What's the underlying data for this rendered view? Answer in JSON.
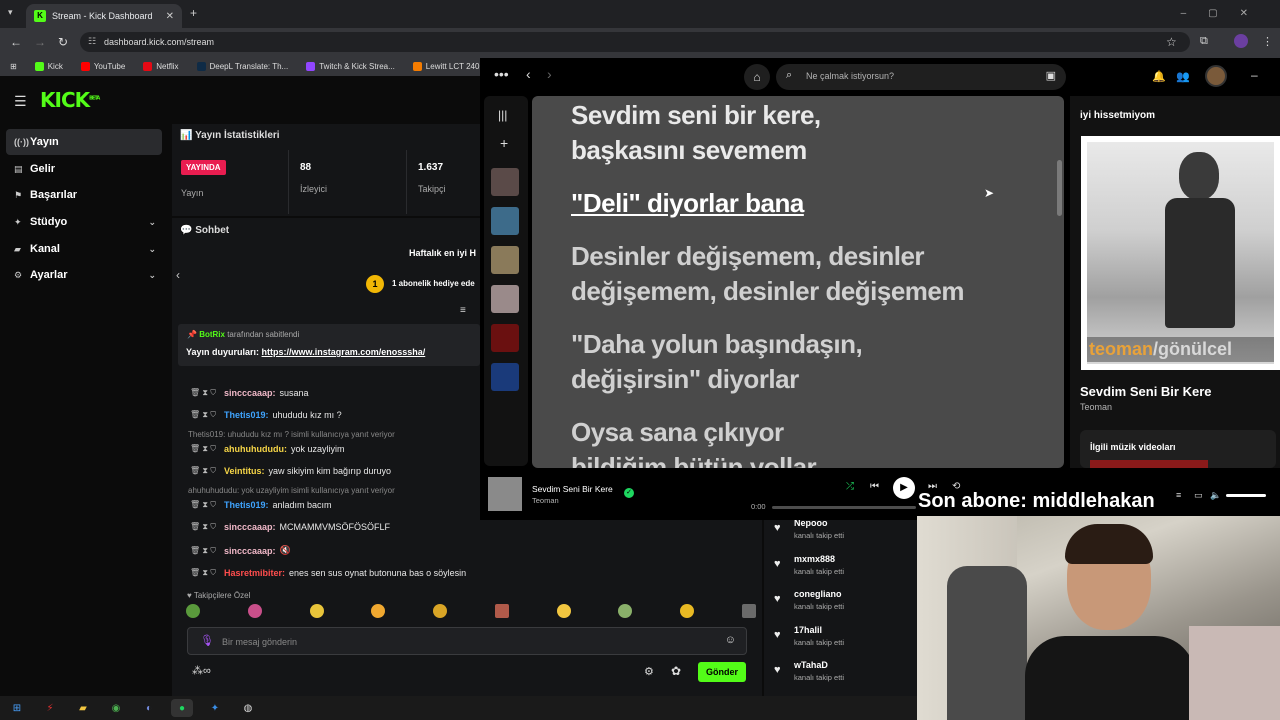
{
  "browser": {
    "tab_title": "Stream - Kick Dashboard",
    "url": "dashboard.kick.com/stream",
    "bookmarks": [
      {
        "label": "Kick",
        "color": "#53fc18"
      },
      {
        "label": "YouTube",
        "color": "#ff0000"
      },
      {
        "label": "Netflix",
        "color": "#e50914"
      },
      {
        "label": "DeepL Translate: Th...",
        "color": "#0f2b46"
      },
      {
        "label": "Twitch & Kick Strea...",
        "color": "#9146ff"
      },
      {
        "label": "Lewitt LCT 240 PRO...",
        "color": "#f57c00"
      }
    ]
  },
  "kick": {
    "logo": "KICK",
    "logo_sup": "BETA",
    "sidebar": [
      {
        "label": "Yayın",
        "icon": "broadcast-icon",
        "glyph": "((·))",
        "active": true,
        "expand": false
      },
      {
        "label": "Gelir",
        "icon": "revenue-icon",
        "glyph": "▤",
        "active": false,
        "expand": false
      },
      {
        "label": "Başarılar",
        "icon": "achievements-icon",
        "glyph": "⚑",
        "active": false,
        "expand": false
      },
      {
        "label": "Stüdyo",
        "icon": "studio-icon",
        "glyph": "✦",
        "active": false,
        "expand": true
      },
      {
        "label": "Kanal",
        "icon": "channel-icon",
        "glyph": "▰",
        "active": false,
        "expand": true
      },
      {
        "label": "Ayarlar",
        "icon": "settings-icon",
        "glyph": "⚙",
        "active": false,
        "expand": true
      }
    ],
    "stats": {
      "title": "Yayın İstatistikleri",
      "live_badge": "YAYINDA",
      "status_label": "Yayın",
      "viewers_value": "88",
      "viewers_label": "İzleyici",
      "followers_value": "1.637",
      "followers_label": "Takipçi"
    },
    "chat": {
      "title": "Sohbet",
      "weekly": "Haftalık en iyi H",
      "gift": "1 abonelik hediye ede",
      "gift_count": "1",
      "pinned_by_user": "BotRix",
      "pinned_by_suffix": "tarafından sabitlendi",
      "pinned_label": "Yayın duyuruları:",
      "pinned_link": "https://www.instagram.com/enosssha/",
      "messages": [
        {
          "user": "sincccaaap:",
          "color": "#f0b8c8",
          "text": "susana"
        },
        {
          "user": "Thetis019:",
          "color": "#3fa4ff",
          "text": "uhududu kız mı ?"
        },
        {
          "user": "ahuhuhududu:",
          "color": "#f5d547",
          "text": "yok uzayliyim"
        },
        {
          "user": "Veintitus:",
          "color": "#f5d547",
          "text": "yaw sikiyim kim bağırıp duruyo"
        },
        {
          "user": "Thetis019:",
          "color": "#3fa4ff",
          "text": "anladım bacım"
        },
        {
          "user": "sincccaaap:",
          "color": "#f0b8c8",
          "text": "MCMAMMVMSÖFÖSÖFLF"
        },
        {
          "user": "sincccaaap:",
          "color": "#f0b8c8",
          "text": ""
        },
        {
          "user": "Hasretmibiter:",
          "color": "#ff4d4d",
          "text": "enes sen sus oynat butonuna bas o söylesin"
        }
      ],
      "reply1": "Thetis019: uhududu kız mı ? isimli kullanıcıya yanıt veriyor",
      "reply2": "ahuhuhududu: yok uzayliyim isimli kullanıcıya yanıt veriyor",
      "followers_only": "Takipçilere Özel",
      "input_placeholder": "Bir mesaj gönderin",
      "send_label": "Gönder",
      "infinity": "∞"
    },
    "feed": [
      {
        "name": "Nepooo",
        "action": "kanalı takip etti"
      },
      {
        "name": "mxmx888",
        "action": "kanalı takip etti"
      },
      {
        "name": "conegliano",
        "action": "kanalı takip etti"
      },
      {
        "name": "17halil",
        "action": "kanalı takip etti"
      },
      {
        "name": "wTahaD",
        "action": "kanalı takip etti"
      }
    ]
  },
  "spotify": {
    "search_placeholder": "Ne çalmak istiyorsun?",
    "lyrics": [
      {
        "text": "Sevdim seni bir kere,",
        "state": "past"
      },
      {
        "text": "başkasını sevemem",
        "state": "past"
      },
      {
        "text": "\"Deli\" diyorlar bana",
        "state": "active"
      },
      {
        "text": "Desinler değişemem, desinler",
        "state": "future"
      },
      {
        "text": "değişemem, desinler değişemem",
        "state": "future"
      },
      {
        "text": "\"Daha yolun başındaşın,",
        "state": "future"
      },
      {
        "text": "değişirsin\" diyorlar",
        "state": "future"
      },
      {
        "text": "Oysa sana çıkıyor",
        "state": "future"
      },
      {
        "text": "bildiğim bütün yollar",
        "state": "future"
      }
    ],
    "right_header": "iyi hissetmiyom",
    "album_text_1": "teoman",
    "album_text_2": "/gönülcel",
    "song_title": "Sevdim Seni Bir Kere",
    "artist": "Teoman",
    "related": "İlgili müzik videoları",
    "time": "0:00"
  },
  "overlay": {
    "last_sub": "Son abone: middlehakan"
  }
}
